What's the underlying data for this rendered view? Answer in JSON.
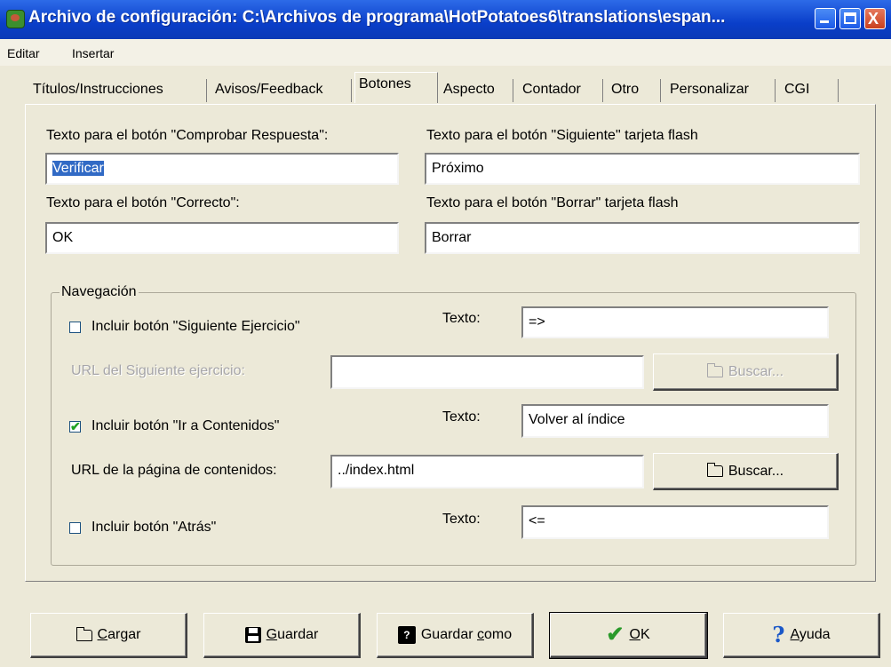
{
  "window": {
    "title": "Archivo de configuración: C:\\Archivos de programa\\HotPotatoes6\\translations\\espan...",
    "min_label": "",
    "max_label": "",
    "close_label": "X"
  },
  "menu": {
    "items": [
      "Editar",
      "Insertar"
    ]
  },
  "tabs": [
    "Títulos/Instrucciones",
    "Avisos/Feedback",
    "Botones",
    "Aspecto",
    "Contador",
    "Otro",
    "Personalizar",
    "CGI"
  ],
  "fields": {
    "check_label": "Texto para el botón \"Comprobar Respuesta\":",
    "check_value": "Verificar",
    "next_flash_label": "Texto para el botón \"Siguiente\" tarjeta flash",
    "next_flash_value": "Próximo",
    "correct_label": "Texto para el botón \"Correcto\":",
    "correct_value": "OK",
    "delete_flash_label": "Texto para el botón \"Borrar\" tarjeta flash",
    "delete_flash_value": "Borrar"
  },
  "navigation": {
    "title": "Navegación",
    "next_exercise": {
      "label": "Incluir botón \"Siguiente Ejercicio\"",
      "checked": false,
      "text_label": "Texto:",
      "text_value": "=>"
    },
    "next_url": {
      "label": "URL del Siguiente ejercicio:",
      "value": "",
      "browse": "Buscar..."
    },
    "contents": {
      "label": "Incluir botón \"Ir a Contenidos\"",
      "checked": true,
      "text_label": "Texto:",
      "text_value": "Volver al índice"
    },
    "contents_url": {
      "label": "URL de la página de contenidos:",
      "value": "../index.html",
      "browse": "Buscar..."
    },
    "back": {
      "label": "Incluir botón \"Atrás\"",
      "checked": false,
      "text_label": "Texto:",
      "text_value": "<="
    }
  },
  "buttons": {
    "load_underline": "C",
    "load_rest": "argar",
    "save_underline": "G",
    "save_rest": "uardar",
    "saveas_pre": "Guardar ",
    "saveas_underline": "c",
    "saveas_rest": "omo",
    "ok_underline": "O",
    "ok_rest": "K",
    "help_underline": "A",
    "help_rest": "yuda"
  },
  "colors": {
    "titlebar": "#0a3ec9",
    "face": "#ece9d8",
    "selection": "#316ac5"
  }
}
